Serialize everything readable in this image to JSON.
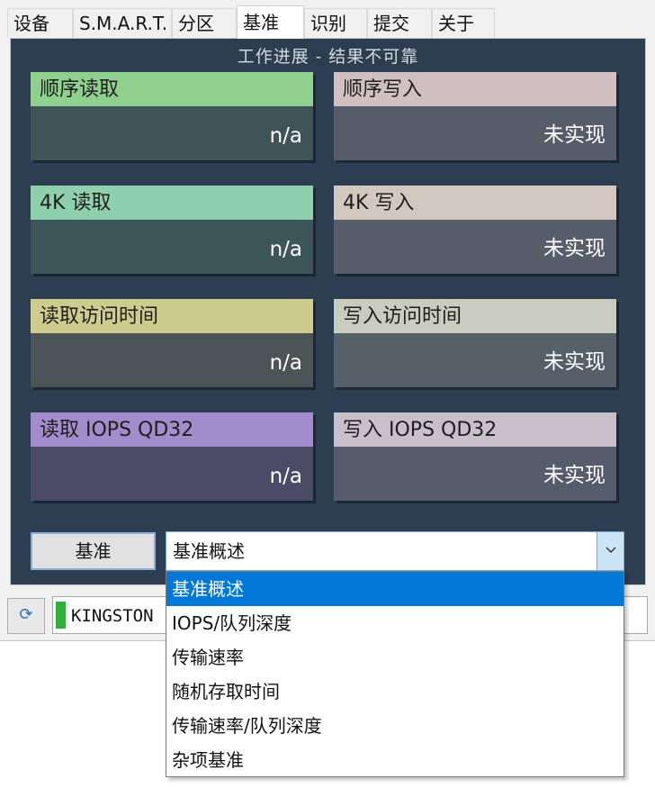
{
  "tabs": [
    "设备",
    "S.M.A.R.T.",
    "分区",
    "基准",
    "识别",
    "提交",
    "关于"
  ],
  "active_tab": "基准",
  "panel_title": "工作进展 - 结果不可靠",
  "cards": [
    {
      "label": "顺序读取",
      "value": "n/a",
      "head_color": "#8fd08f",
      "body_color": "#3e5457"
    },
    {
      "label": "顺序写入",
      "value": "未实现",
      "head_color": "#d0c0c2",
      "body_color": "#575c69"
    },
    {
      "label": "4K 读取",
      "value": "n/a",
      "head_color": "#8ecfae",
      "body_color": "#3d5659"
    },
    {
      "label": "4K 写入",
      "value": "未实现",
      "head_color": "#d2c8c0",
      "body_color": "#575e69"
    },
    {
      "label": "读取访问时间",
      "value": "n/a",
      "head_color": "#cdcc8e",
      "body_color": "#4d5456"
    },
    {
      "label": "写入访问时间",
      "value": "未实现",
      "head_color": "#c9ccbe",
      "body_color": "#566069"
    },
    {
      "label": "读取 IOPS QD32",
      "value": "n/a",
      "head_color": "#a38ccb",
      "body_color": "#4a4b66"
    },
    {
      "label": "写入 IOPS QD32",
      "value": "未实现",
      "head_color": "#c8bfca",
      "body_color": "#575c6d"
    }
  ],
  "benchmark_button": "基准",
  "combo": {
    "selected": "基准概述"
  },
  "dropdown_options": [
    "基准概述",
    "IOPS/队列深度",
    "传输速率",
    "随机存取时间",
    "传输速率/队列深度",
    "杂项基准"
  ],
  "drive": {
    "text": "KINGSTON",
    "status_color": "#2fae3b"
  },
  "icons": {
    "refresh": "refresh-icon",
    "combo_arrow": "chevron-down-icon"
  }
}
